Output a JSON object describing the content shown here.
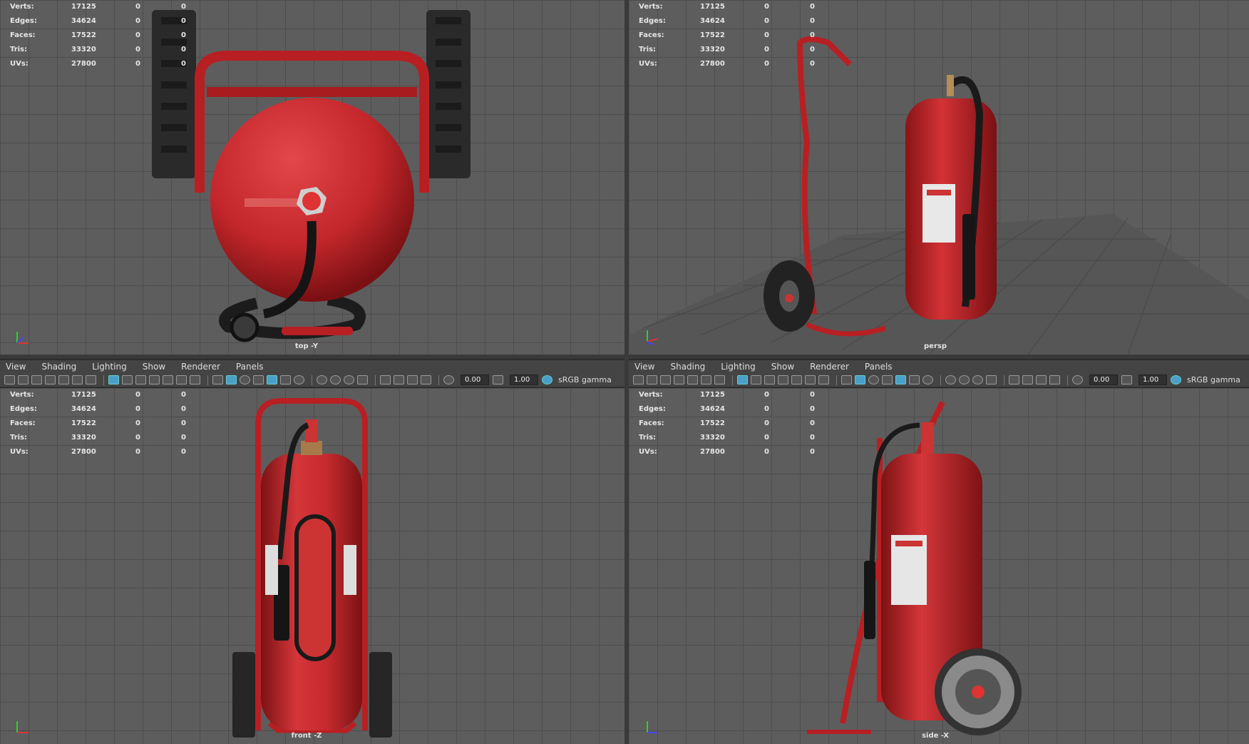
{
  "stats_rows": [
    {
      "label": "Verts:",
      "v1": "17125",
      "v2": "0",
      "v3": "0"
    },
    {
      "label": "Edges:",
      "v1": "34624",
      "v2": "0",
      "v3": "0"
    },
    {
      "label": "Faces:",
      "v1": "17522",
      "v2": "0",
      "v3": "0"
    },
    {
      "label": "Tris:",
      "v1": "33320",
      "v2": "0",
      "v3": "0"
    },
    {
      "label": "UVs:",
      "v1": "27800",
      "v2": "0",
      "v3": "0"
    }
  ],
  "viewports": {
    "top": {
      "camera": "top -Y"
    },
    "persp": {
      "camera": "persp"
    },
    "front": {
      "camera": "front -Z"
    },
    "side": {
      "camera": "side -X"
    }
  },
  "menu": {
    "view": "View",
    "shading": "Shading",
    "lighting": "Lighting",
    "show": "Show",
    "renderer": "Renderer",
    "panels": "Panels"
  },
  "toolbar": {
    "exposure": "0.00",
    "gamma": "1.00",
    "colorspace": "sRGB gamma"
  },
  "colors": {
    "viewport_bg": "#5d5d5d",
    "extinguisher_red": "#c8262a",
    "menubar": "#444444",
    "active_tool": "#4aa0c8"
  },
  "icons": [
    "camera-icon",
    "bookmark-icon",
    "grid-icon",
    "wireframe-icon",
    "smooth-shade-icon",
    "texture-icon",
    "light-icon",
    "shadow-icon",
    "isolate-icon",
    "exposure-icon",
    "gamma-icon",
    "colorspace-icon"
  ]
}
